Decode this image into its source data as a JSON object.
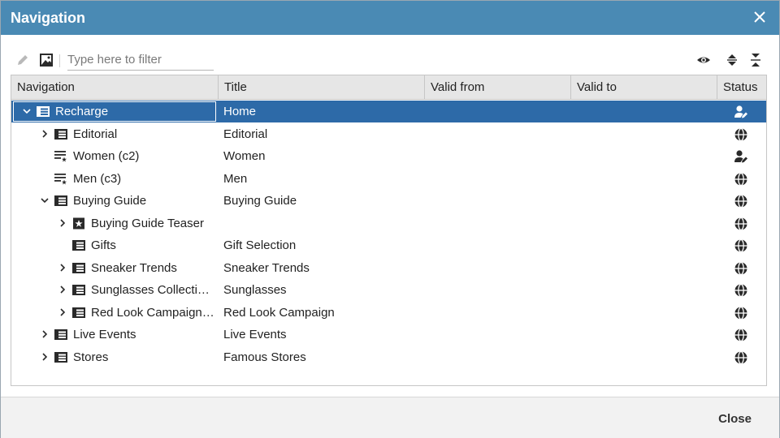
{
  "dialog": {
    "title": "Navigation",
    "close_button": "Close"
  },
  "toolbar": {
    "edit_icon": "pencil-icon",
    "image_icon": "picture-icon",
    "filter_placeholder": "Type here to filter",
    "filter_value": "",
    "preview_icon": "eye-icon",
    "expand_icon": "expand-all-icon",
    "collapse_icon": "collapse-all-icon"
  },
  "columns": [
    "Navigation",
    "Title",
    "Valid from",
    "Valid to",
    "Status"
  ],
  "rows": [
    {
      "name": "Recharge",
      "title": "Home",
      "valid_from": "",
      "valid_to": "",
      "status": "user-edit-icon",
      "expanded": true,
      "has_children": true,
      "selected": true,
      "icon": "page-icon",
      "depth": 0
    },
    {
      "name": "Editorial",
      "title": "Editorial",
      "valid_from": "",
      "valid_to": "",
      "status": "globe-icon",
      "expanded": false,
      "has_children": true,
      "icon": "page-icon",
      "depth": 1
    },
    {
      "name": "Women (c2)",
      "title": "Women",
      "valid_from": "",
      "valid_to": "",
      "status": "user-edit-icon",
      "expanded": false,
      "has_children": false,
      "icon": "list-star-icon",
      "depth": 1
    },
    {
      "name": "Men (c3)",
      "title": "Men",
      "valid_from": "",
      "valid_to": "",
      "status": "globe-icon",
      "expanded": false,
      "has_children": false,
      "icon": "list-star-icon",
      "depth": 1
    },
    {
      "name": "Buying Guide",
      "title": "Buying Guide",
      "valid_from": "",
      "valid_to": "",
      "status": "globe-icon",
      "expanded": true,
      "has_children": true,
      "icon": "page-icon",
      "depth": 1
    },
    {
      "name": "Buying Guide Teaser",
      "title": "",
      "valid_from": "",
      "valid_to": "",
      "status": "globe-icon",
      "expanded": false,
      "has_children": true,
      "icon": "teaser-icon",
      "depth": 2
    },
    {
      "name": "Gifts",
      "title": "Gift Selection",
      "valid_from": "",
      "valid_to": "",
      "status": "globe-icon",
      "expanded": false,
      "has_children": false,
      "icon": "page-icon",
      "depth": 2
    },
    {
      "name": "Sneaker Trends",
      "title": "Sneaker Trends",
      "valid_from": "",
      "valid_to": "",
      "status": "globe-icon",
      "expanded": false,
      "has_children": true,
      "icon": "page-icon",
      "depth": 2
    },
    {
      "name": "Sunglasses Collecti…",
      "title": "Sunglasses",
      "valid_from": "",
      "valid_to": "",
      "status": "globe-icon",
      "expanded": false,
      "has_children": true,
      "icon": "page-icon",
      "depth": 2
    },
    {
      "name": "Red Look Campaign…",
      "title": "Red Look Campaign",
      "valid_from": "",
      "valid_to": "",
      "status": "globe-icon",
      "expanded": false,
      "has_children": true,
      "icon": "page-icon",
      "depth": 2
    },
    {
      "name": "Live Events",
      "title": "Live Events",
      "valid_from": "",
      "valid_to": "",
      "status": "globe-icon",
      "expanded": false,
      "has_children": true,
      "icon": "page-icon",
      "depth": 1
    },
    {
      "name": "Stores",
      "title": "Famous Stores",
      "valid_from": "",
      "valid_to": "",
      "status": "globe-icon",
      "expanded": false,
      "has_children": true,
      "icon": "page-icon",
      "depth": 1
    }
  ],
  "colors": {
    "titlebar": "#4a8ab4",
    "selection": "#2d6aa8",
    "header": "#e6e6e6"
  }
}
